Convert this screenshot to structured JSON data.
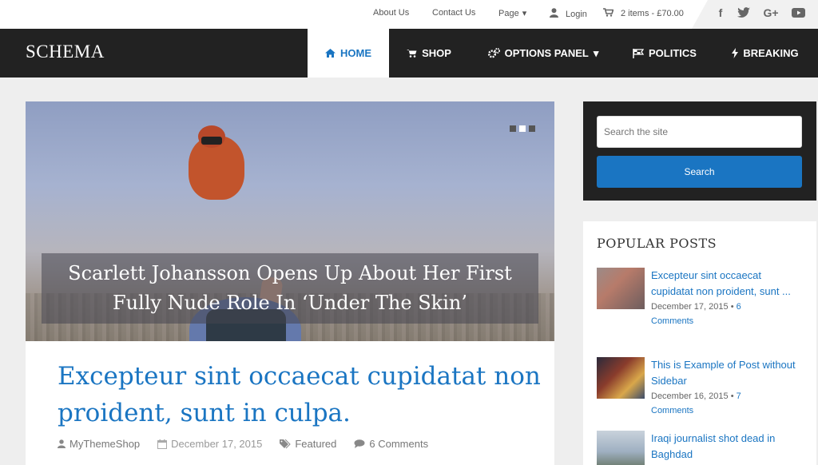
{
  "topbar": {
    "links": [
      "About Us",
      "Contact Us",
      "Page"
    ],
    "login": "Login",
    "cart": "2 items - £70.00",
    "social_icons": [
      "facebook-icon",
      "twitter-icon",
      "google-plus-icon",
      "youtube-icon"
    ]
  },
  "brand": "SCHEMA",
  "nav": {
    "items": [
      {
        "label": "HOME",
        "icon": "home-icon",
        "active": true
      },
      {
        "label": "SHOP",
        "icon": "cart-icon"
      },
      {
        "label": "OPTIONS PANEL",
        "icon": "gears-icon",
        "has_dropdown": true
      },
      {
        "label": "POLITICS",
        "icon": "flag-icon"
      },
      {
        "label": "BREAKING",
        "icon": "bolt-icon"
      }
    ]
  },
  "slider": {
    "caption": "Scarlett Johansson Opens Up About Her First Fully Nude Role In ‘Under The Skin’",
    "slide_count": 3,
    "active_slide": 2
  },
  "post": {
    "title": "Excepteur sint occaecat cupidatat non proident, sunt in culpa.",
    "author": "MyThemeShop",
    "date": "December 17, 2015",
    "category": "Featured",
    "comments": "6 Comments"
  },
  "search": {
    "placeholder": "Search the site",
    "button": "Search"
  },
  "popular": {
    "title": "POPULAR POSTS",
    "items": [
      {
        "title": "Excepteur sint occaecat cupidatat non proident, sunt ...",
        "date": "December 17, 2015",
        "count": "6",
        "comments_label": "Comments"
      },
      {
        "title": "This is Example of Post without Sidebar",
        "date": "December 16, 2015",
        "count": "7",
        "comments_label": "Comments"
      },
      {
        "title": "Iraqi journalist shot dead in Baghdad",
        "date": "",
        "count": "",
        "comments_label": ""
      }
    ]
  },
  "colors": {
    "accent": "#1a75c2",
    "nav_bg": "#222222",
    "page_bg": "#eeeeee"
  }
}
